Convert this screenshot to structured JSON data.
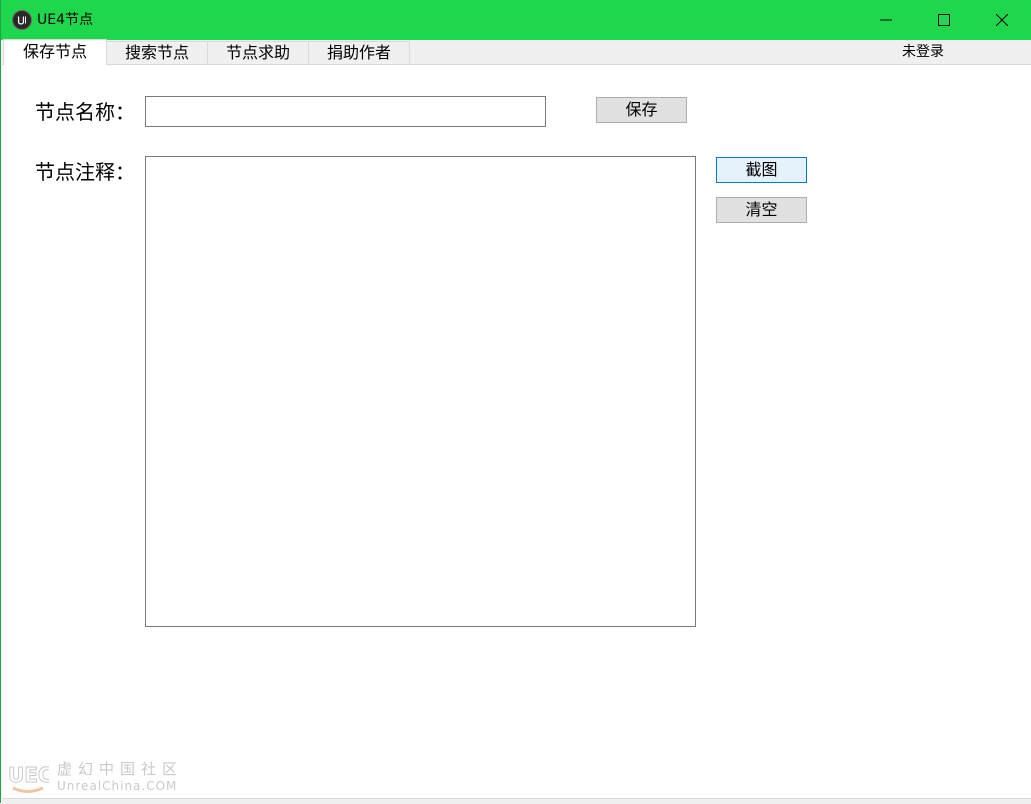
{
  "window": {
    "title": "UE4节点",
    "accent_color": "#1ed74c",
    "icons": {
      "app": "unreal-logo-icon",
      "minimize": "minimize-icon",
      "maximize": "maximize-icon",
      "close": "close-icon"
    }
  },
  "tabs": [
    {
      "label": "保存节点",
      "active": true
    },
    {
      "label": "搜索节点",
      "active": false
    },
    {
      "label": "节点求助",
      "active": false
    },
    {
      "label": "捐助作者",
      "active": false
    }
  ],
  "login_status": "未登录",
  "form": {
    "name_label": "节点名称：",
    "name_value": "",
    "save_label": "保存",
    "note_label": "节点注释：",
    "note_value": "",
    "screenshot_label": "截图",
    "clear_label": "清空"
  },
  "watermark": {
    "cn_text": "虚幻中国社区",
    "en_text": "UnrealChina.COM"
  }
}
